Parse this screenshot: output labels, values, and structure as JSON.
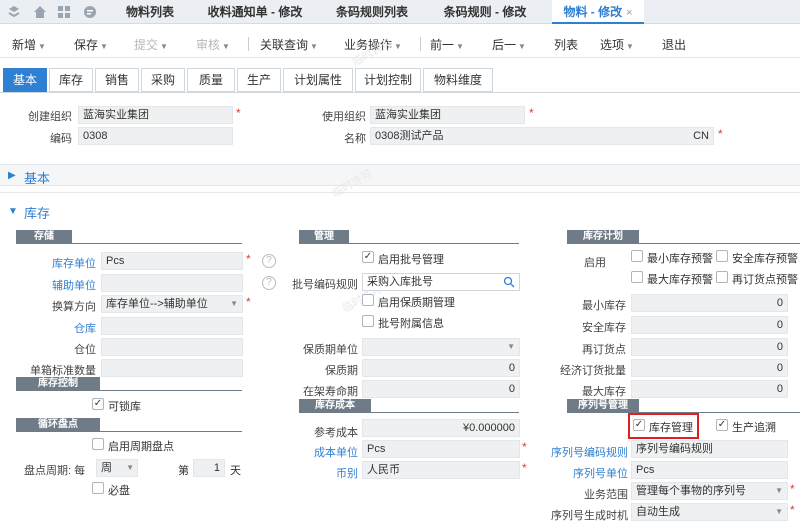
{
  "topbar": {
    "tabs": [
      "物料列表",
      "收料通知单 - 修改",
      "条码规则列表",
      "条码规则 - 修改",
      "物料 - 修改"
    ],
    "close": "×"
  },
  "toolbar": {
    "items": [
      "新增",
      "保存",
      "提交",
      "审核",
      "关联查询",
      "业务操作",
      "前一",
      "后一",
      "列表",
      "选项",
      "退出"
    ]
  },
  "subtabs": [
    "基本",
    "库存",
    "销售",
    "采购",
    "质量",
    "生产",
    "计划属性",
    "计划控制",
    "物料维度"
  ],
  "header_fields": {
    "create_org_label": "创建组织",
    "create_org": "蓝海实业集团",
    "use_org_label": "使用组织",
    "use_org": "蓝海实业集团",
    "code_label": "编码",
    "code": "0308",
    "name_label": "名称",
    "name": "0308测试产品",
    "lang": "CN"
  },
  "sections": {
    "basic": "基本",
    "inventory": "库存"
  },
  "watermark": "临时许可",
  "storage": {
    "title": "存储",
    "unit_label": "库存单位",
    "unit": "Pcs",
    "aux_unit_label": "辅助单位",
    "aux_unit": "",
    "conv_label": "换算方向",
    "conv": "库存单位-->辅助单位",
    "warehouse_label": "仓库",
    "location_label": "仓位",
    "box_label": "单箱标准数量"
  },
  "inv_control": {
    "title": "库存控制",
    "lockable": "可锁库"
  },
  "cycle": {
    "title": "循环盘点",
    "enable": "启用周期盘点",
    "period_label": "盘点周期: 每",
    "period_unit": "周",
    "nth_label": "第",
    "nth": "1",
    "day": "天",
    "must": "必盘"
  },
  "manage": {
    "title": "管理",
    "batch": "启用批号管理",
    "batch_rule_label": "批号编码规则",
    "batch_rule": "采购入库批号",
    "shelf": "启用保质期管理",
    "batch_extra": "批号附属信息",
    "shelf_unit_label": "保质期单位",
    "shelf_unit": "",
    "shelf_label": "保质期",
    "shelf_val": "0",
    "life_label": "在架寿命期",
    "life_val": "0"
  },
  "cost": {
    "title": "库存成本",
    "ref_label": "参考成本",
    "ref": "¥0.000000",
    "unit_label": "成本单位",
    "unit": "Pcs",
    "currency_label": "币别",
    "currency": "人民币"
  },
  "plan": {
    "title": "库存计划",
    "enable_label": "启用",
    "min_warn": "最小库存预警",
    "safe_warn": "安全库存预警",
    "max_warn": "最大库存预警",
    "reorder_warn": "再订货点预警",
    "min_label": "最小库存",
    "min": "0",
    "safe_label": "安全库存",
    "safe": "0",
    "reorder_label": "再订货点",
    "reorder": "0",
    "eoq_label": "经济订货批量",
    "eoq": "0",
    "max_label": "最大库存",
    "max": "0"
  },
  "serial": {
    "title": "序列号管理",
    "inv_mgmt": "库存管理",
    "trace": "生产追溯",
    "rule_label": "序列号编码规则",
    "rule": "序列号编码规则",
    "unit_label": "序列号单位",
    "unit": "Pcs",
    "scope_label": "业务范围",
    "scope": "管理每个事物的序列号",
    "gen_label": "序列号生成时机",
    "gen": "自动生成"
  },
  "colors": {
    "accent": "#2f7fd3",
    "highlight": "#e02020"
  }
}
